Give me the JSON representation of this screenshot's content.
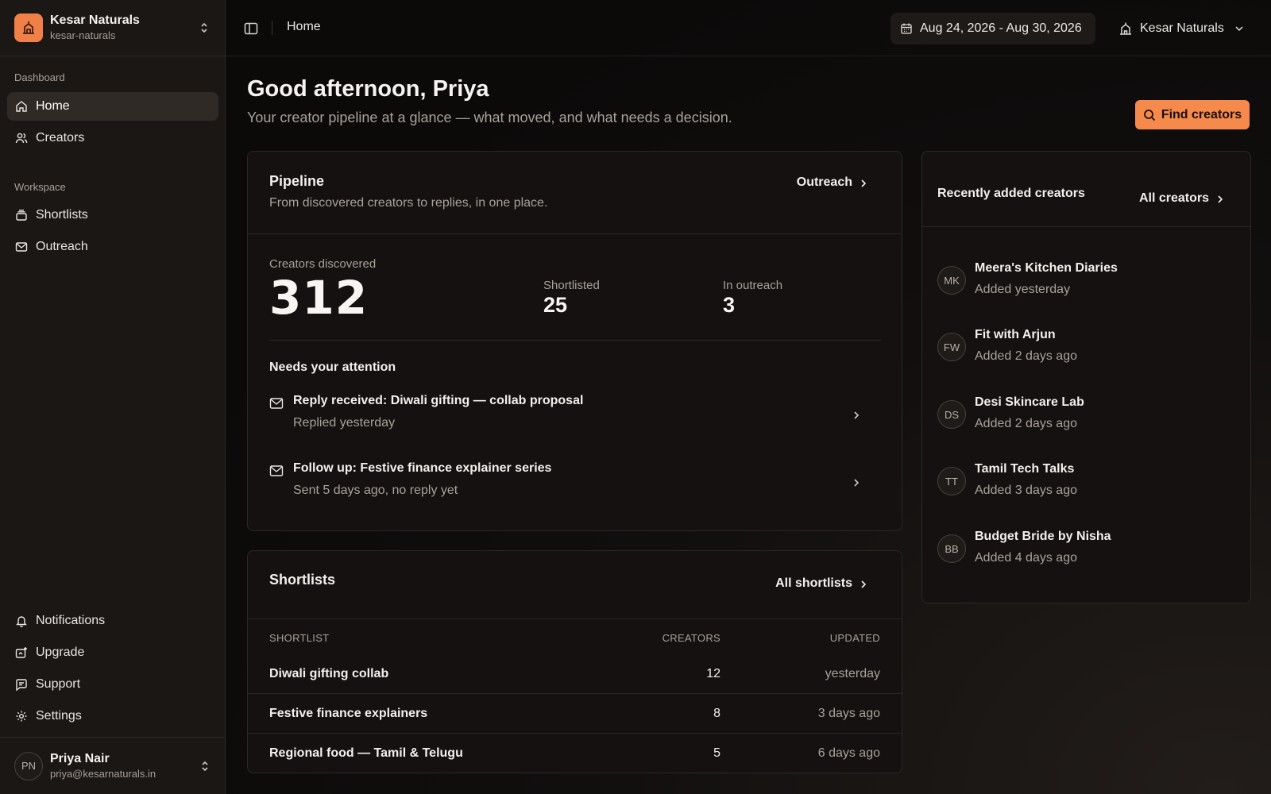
{
  "brand": {
    "name": "Kesar Naturals",
    "slug": "kesar-naturals"
  },
  "sidebar": {
    "sections": [
      {
        "label": "Dashboard",
        "items": [
          {
            "label": "Home",
            "icon": "home-icon",
            "active": true
          },
          {
            "label": "Creators",
            "icon": "users-icon"
          }
        ]
      },
      {
        "label": "Workspace",
        "items": [
          {
            "label": "Shortlists",
            "icon": "shortlist-icon"
          },
          {
            "label": "Outreach",
            "icon": "mail-icon"
          }
        ]
      }
    ],
    "bottom_items": [
      {
        "label": "Notifications",
        "icon": "bell-icon"
      },
      {
        "label": "Upgrade",
        "icon": "sparkle-icon"
      },
      {
        "label": "Support",
        "icon": "chat-icon"
      },
      {
        "label": "Settings",
        "icon": "gear-icon"
      }
    ]
  },
  "user": {
    "initials": "PN",
    "name": "Priya Nair",
    "email": "priya@kesarnaturals.in"
  },
  "topbar": {
    "breadcrumb": "Home",
    "date_range": "Aug 24, 2026 - Aug 30, 2026",
    "org": "Kesar Naturals"
  },
  "header": {
    "greeting": "Good afternoon, Priya",
    "subtitle": "Your creator pipeline at a glance — what moved, and what needs a decision.",
    "find_button": "Find creators"
  },
  "pipeline": {
    "title": "Pipeline",
    "description": "From discovered creators to replies, in one place.",
    "link": "Outreach",
    "discovered_label": "Creators discovered",
    "discovered_value": "312",
    "shortlisted_label": "Shortlisted",
    "shortlisted_value": "25",
    "outreach_label": "In outreach",
    "outreach_value": "3",
    "attention_title": "Needs your attention",
    "attention": [
      {
        "title": "Reply received: Diwali gifting — collab proposal",
        "subtitle": "Replied yesterday"
      },
      {
        "title": "Follow up: Festive finance explainer series",
        "subtitle": "Sent 5 days ago, no reply yet"
      }
    ]
  },
  "shortlists": {
    "title": "Shortlists",
    "link": "All shortlists",
    "columns": [
      "SHORTLIST",
      "CREATORS",
      "UPDATED"
    ],
    "rows": [
      {
        "name": "Diwali gifting collab",
        "creators": "12",
        "updated": "yesterday"
      },
      {
        "name": "Festive finance explainers",
        "creators": "8",
        "updated": "3 days ago"
      },
      {
        "name": "Regional food — Tamil & Telugu",
        "creators": "5",
        "updated": "6 days ago"
      }
    ]
  },
  "recent": {
    "title": "Recently added creators",
    "link": "All creators",
    "creators": [
      {
        "initials": "MK",
        "name": "Meera's Kitchen Diaries",
        "added": "Added yesterday"
      },
      {
        "initials": "FW",
        "name": "Fit with Arjun",
        "added": "Added 2 days ago"
      },
      {
        "initials": "DS",
        "name": "Desi Skincare Lab",
        "added": "Added 2 days ago"
      },
      {
        "initials": "TT",
        "name": "Tamil Tech Talks",
        "added": "Added 3 days ago"
      },
      {
        "initials": "BB",
        "name": "Budget Bride by Nisha",
        "added": "Added 4 days ago"
      }
    ]
  },
  "colors": {
    "accent": "#f58a4c",
    "sidebar_bg": "#1b1715",
    "card_bg": "#141110"
  }
}
